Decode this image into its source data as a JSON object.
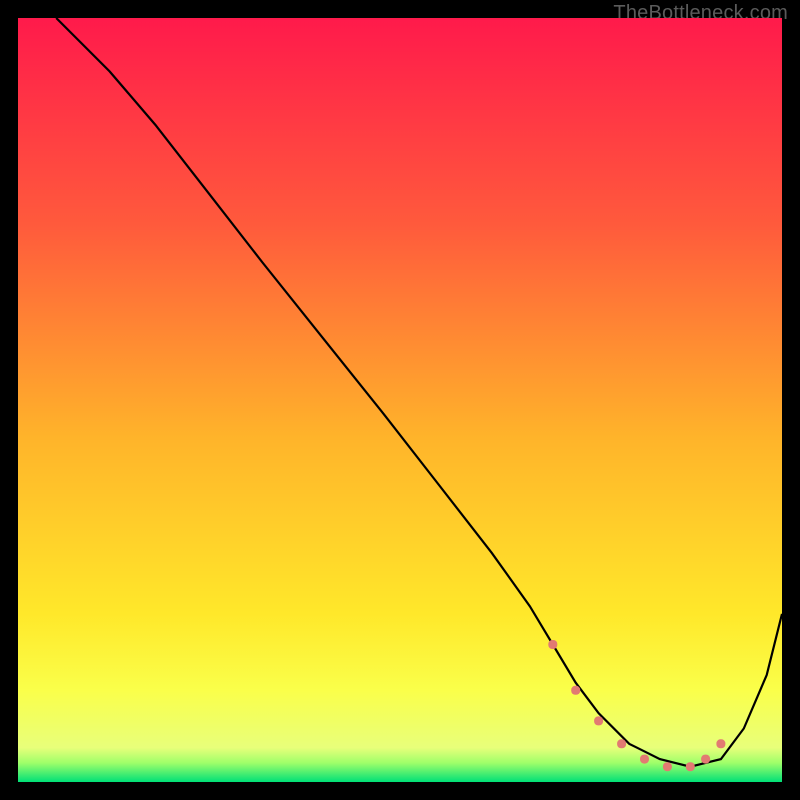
{
  "attribution": "TheBottleneck.com",
  "chart_data": {
    "type": "line",
    "title": "",
    "xlabel": "",
    "ylabel": "",
    "xlim": [
      0,
      100
    ],
    "ylim": [
      0,
      100
    ],
    "background_gradient": [
      {
        "stop": 0.0,
        "color": "#ff1a4b"
      },
      {
        "stop": 0.27,
        "color": "#ff5a3c"
      },
      {
        "stop": 0.55,
        "color": "#ffb42a"
      },
      {
        "stop": 0.78,
        "color": "#ffe82a"
      },
      {
        "stop": 0.88,
        "color": "#faff4a"
      },
      {
        "stop": 0.955,
        "color": "#e8ff7a"
      },
      {
        "stop": 0.975,
        "color": "#9fff6a"
      },
      {
        "stop": 1.0,
        "color": "#00e077"
      }
    ],
    "curve": {
      "x": [
        5,
        8,
        12,
        18,
        25,
        32,
        40,
        48,
        55,
        62,
        67,
        70,
        73,
        76,
        80,
        84,
        88,
        92,
        95,
        98,
        100
      ],
      "y": [
        100,
        97,
        93,
        86,
        77,
        68,
        58,
        48,
        39,
        30,
        23,
        18,
        13,
        9,
        5,
        3,
        2,
        3,
        7,
        14,
        22
      ]
    },
    "markers": {
      "x": [
        70,
        73,
        76,
        79,
        82,
        85,
        88,
        90,
        92
      ],
      "y": [
        18,
        12,
        8,
        5,
        3,
        2,
        2,
        3,
        5
      ],
      "color": "#e27a72",
      "size": 9
    }
  }
}
